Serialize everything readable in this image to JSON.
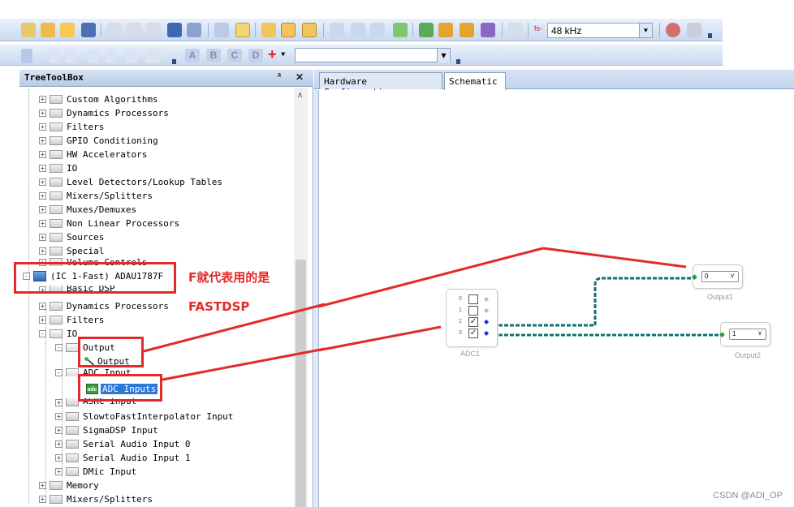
{
  "toolbar": {
    "sample_rate_value": "48 kHz",
    "sample_rate_label": "fs-",
    "letter_buttons": [
      "A",
      "B",
      "C",
      "D"
    ],
    "plus_label": "+"
  },
  "tree_panel": {
    "title": "TreeToolBox",
    "pin_label": "ป",
    "close_label": "✕",
    "items": [
      {
        "label": "Custom Algorithms",
        "expander": "+"
      },
      {
        "label": "Dynamics Processors",
        "expander": "+"
      },
      {
        "label": "Filters",
        "expander": "+"
      },
      {
        "label": "GPIO Conditioning",
        "expander": "+"
      },
      {
        "label": "HW Accelerators",
        "expander": "+"
      },
      {
        "label": "IO",
        "expander": "+"
      },
      {
        "label": "Level Detectors/Lookup Tables",
        "expander": "+"
      },
      {
        "label": "Mixers/Splitters",
        "expander": "+"
      },
      {
        "label": "Muxes/Demuxes",
        "expander": "+"
      },
      {
        "label": "Non Linear Processors",
        "expander": "+"
      },
      {
        "label": "Sources",
        "expander": "+"
      },
      {
        "label": "Special",
        "expander": "+"
      },
      {
        "label": "Volume Controls",
        "expander": "+"
      },
      {
        "label": "(IC 1-Fast) ADAU1787F",
        "expander": "-"
      },
      {
        "label": "Basic DSP",
        "expander": "+"
      },
      {
        "label": "Dynamics Processors",
        "expander": "+"
      },
      {
        "label": "Filters",
        "expander": "+"
      },
      {
        "label": "IO",
        "expander": "-"
      },
      {
        "label": "Output",
        "expander": "-"
      },
      {
        "label": "Output",
        "expander": ""
      },
      {
        "label": "ADC Input",
        "expander": "-"
      },
      {
        "label": "ADC Inputs",
        "expander": ""
      },
      {
        "label": "ASRC Input",
        "expander": "+"
      },
      {
        "label": "SlowtoFastInterpolator Input",
        "expander": "+"
      },
      {
        "label": "SigmaDSP Input",
        "expander": "+"
      },
      {
        "label": "Serial Audio Input 0",
        "expander": "+"
      },
      {
        "label": "Serial Audio Input 1",
        "expander": "+"
      },
      {
        "label": "DMic Input",
        "expander": "+"
      },
      {
        "label": "Memory",
        "expander": "+"
      },
      {
        "label": "Mixers/Splitters",
        "expander": "+"
      }
    ],
    "adc_icon_text": "adc"
  },
  "tabs": [
    {
      "label": "Hardware Configuration"
    },
    {
      "label": "Schematic"
    }
  ],
  "schematic": {
    "adc_block": {
      "caption": "ADC1",
      "pins": [
        "0",
        "1",
        "2",
        "3"
      ],
      "checked": [
        false,
        false,
        true,
        true
      ]
    },
    "output1": {
      "caption": "Output1",
      "value": "0"
    },
    "output2": {
      "caption": "Output2",
      "value": "1"
    },
    "wire_color": "#1a8a8a"
  },
  "annotation": {
    "line1": "F就代表用的是",
    "line2": "FASTDSP",
    "color": "#e32a2a"
  },
  "watermark": "CSDN @ADI_OP"
}
